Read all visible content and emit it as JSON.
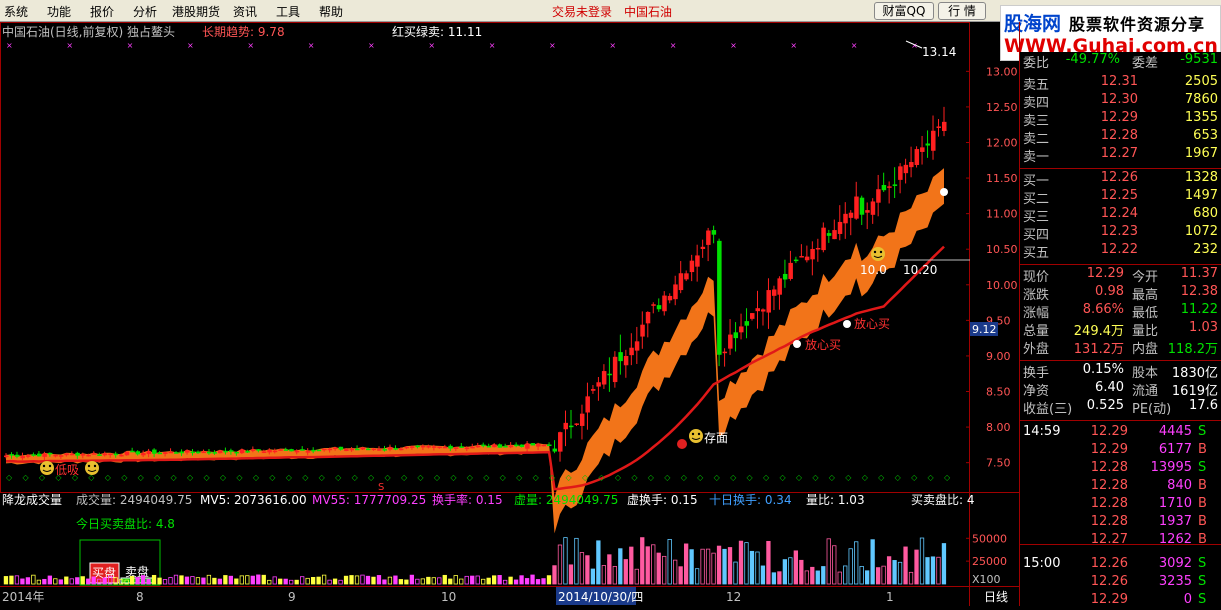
{
  "menu": [
    "系统",
    "功能",
    "报价",
    "分析",
    "港股期货",
    "资讯",
    "工具",
    "帮助"
  ],
  "login_status": "交易未登录",
  "stock_name": "中国石油",
  "buttons": {
    "wealth": "财富QQ",
    "quote": "行 情"
  },
  "logo": {
    "name": "股海网",
    "slogan": "股票软件资源分享",
    "url": "WWW.Guhai.com.cn"
  },
  "chart_header": {
    "title": "中国石油(日线,前复权) 独占鳌头",
    "long_trend_label": "长期趋势: 9.78",
    "red_buy_label": "红买绿卖: 11.11"
  },
  "volume_header": {
    "name": "降龙成交量",
    "items": [
      {
        "label": "成交量: 2494049.75",
        "color": "#c0c0c0"
      },
      {
        "label": "MV5: 2073616.00",
        "color": "#ffffff"
      },
      {
        "label": "MV55: 1777709.25",
        "color": "#ff40ff"
      },
      {
        "label": "换手率: 0.15",
        "color": "#ff40ff"
      },
      {
        "label": "虚量: 2494049.75",
        "color": "#00e000"
      },
      {
        "label": "虚换手: 0.15",
        "color": "#ffffff"
      },
      {
        "label": "十日换手: 0.34",
        "color": "#40a0ff"
      },
      {
        "label": "量比: 1.03",
        "color": "#ffffff"
      },
      {
        "label": "买卖盘比: 4",
        "color": "#ffffff"
      }
    ]
  },
  "buy_sell_ratio_label": "今日买卖盘比: 4.8",
  "buy_label": "买盘",
  "sell_label": "卖盘",
  "annotations": {
    "high": "13.14",
    "low_label_1": "10.0",
    "low_label_2": "10.20",
    "relax_buy": "放心买",
    "face_label": "存面",
    "bottom_label": "低吸",
    "s_marker": "S",
    "cursor_price": "9.12",
    "vol_unit": "X100"
  },
  "price_axis": [
    "13.00",
    "12.50",
    "12.00",
    "11.50",
    "11.00",
    "10.50",
    "10.00",
    "9.50",
    "9.00",
    "8.50",
    "8.00",
    "7.50"
  ],
  "volume_axis": [
    "50000",
    "25000"
  ],
  "date_axis": [
    {
      "label": "2014年"
    },
    {
      "label": "8"
    },
    {
      "label": "9"
    },
    {
      "label": "10"
    },
    {
      "label": "2014/10/30/四",
      "highlight": true
    },
    {
      "label": "12"
    },
    {
      "label": "1"
    },
    {
      "label": "日线"
    }
  ],
  "quote": {
    "wei": {
      "l1": "委比",
      "v1": "-49.77%",
      "l2": "委差",
      "v2": "-9531"
    },
    "sell": [
      {
        "label": "卖五",
        "price": "12.31",
        "vol": "2505"
      },
      {
        "label": "卖四",
        "price": "12.30",
        "vol": "7860"
      },
      {
        "label": "卖三",
        "price": "12.29",
        "vol": "1355"
      },
      {
        "label": "卖二",
        "price": "12.28",
        "vol": "653"
      },
      {
        "label": "卖一",
        "price": "12.27",
        "vol": "1967"
      }
    ],
    "buy": [
      {
        "label": "买一",
        "price": "12.26",
        "vol": "1328"
      },
      {
        "label": "买二",
        "price": "12.25",
        "vol": "1497"
      },
      {
        "label": "买三",
        "price": "12.24",
        "vol": "680"
      },
      {
        "label": "买四",
        "price": "12.23",
        "vol": "1072"
      },
      {
        "label": "买五",
        "price": "12.22",
        "vol": "232"
      }
    ],
    "stats": [
      {
        "l1": "现价",
        "v1": "12.29",
        "l2": "今开",
        "v2": "11.37"
      },
      {
        "l1": "涨跌",
        "v1": "0.98",
        "l2": "最高",
        "v2": "12.38"
      },
      {
        "l1": "涨幅",
        "v1": "8.66%",
        "l2": "最低",
        "v2": "11.22"
      },
      {
        "l1": "总量",
        "v1": "249.4万",
        "l2": "量比",
        "v2": "1.03"
      },
      {
        "l1": "外盘",
        "v1": "131.2万",
        "l2": "内盘",
        "v2": "118.2万"
      }
    ],
    "stats2": [
      {
        "l1": "换手",
        "v1": "0.15%",
        "l2": "股本",
        "v2": "1830亿"
      },
      {
        "l1": "净资",
        "v1": "6.40",
        "l2": "流通",
        "v2": "1619亿"
      },
      {
        "l1": "收益(三)",
        "v1": "0.525",
        "l2": "PE(动)",
        "v2": "17.6"
      }
    ],
    "ticks": [
      {
        "time": "14:59",
        "price": "12.29",
        "vol": "4445",
        "side": "S"
      },
      {
        "time": "",
        "price": "12.29",
        "vol": "6177",
        "side": "B"
      },
      {
        "time": "",
        "price": "12.28",
        "vol": "13995",
        "side": "S"
      },
      {
        "time": "",
        "price": "12.28",
        "vol": "840",
        "side": "B"
      },
      {
        "time": "",
        "price": "12.28",
        "vol": "1710",
        "side": "B"
      },
      {
        "time": "",
        "price": "12.28",
        "vol": "1937",
        "side": "B"
      },
      {
        "time": "",
        "price": "12.27",
        "vol": "1262",
        "side": "B"
      },
      {
        "time": "15:00",
        "price": "12.26",
        "vol": "3092",
        "side": "S"
      },
      {
        "time": "",
        "price": "12.26",
        "vol": "3235",
        "side": "S"
      },
      {
        "time": "",
        "price": "12.29",
        "vol": "0",
        "side": "S"
      }
    ]
  },
  "chart_data": [
    {
      "type": "candlestick",
      "title": "中国石油(日线,前复权)",
      "ylim": [
        7.2,
        13.3
      ],
      "dates_shown": [
        "2014年",
        "8",
        "9",
        "10",
        "2014/10/30",
        "12",
        "1"
      ],
      "phases": [
        {
          "start_index": 0,
          "end_index": 100,
          "price_from": 7.6,
          "price_to": 7.75,
          "note": "flat consolidation"
        },
        {
          "start_index": 100,
          "end_index": 130,
          "price_from": 7.75,
          "price_to": 10.9,
          "note": "breakout rally"
        },
        {
          "start_index": 130,
          "end_index": 156,
          "price_from": 9.1,
          "price_to": 11.3,
          "note": "pullback then rebound"
        },
        {
          "start_index": 156,
          "end_index": 172,
          "price_from": 11.0,
          "price_to": 12.29,
          "note": "new highs"
        }
      ],
      "high": 13.14,
      "last_close": 12.29,
      "long_trend": 9.78,
      "red_buy_green_sell": 11.11
    },
    {
      "type": "bar",
      "title": "降龙成交量",
      "ylim": [
        0,
        70000
      ],
      "volume": 2494049.75,
      "mv5": 2073616.0,
      "mv55": 1777709.25
    }
  ]
}
